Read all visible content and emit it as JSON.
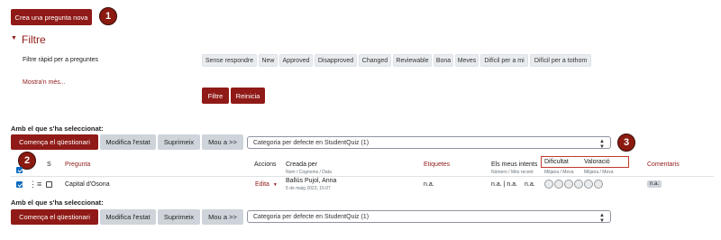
{
  "top": {
    "create_button": "Crea una pregunta nova",
    "callout_1": "1"
  },
  "filter": {
    "heading": "Filtre",
    "quick_label": "Filtre ràpid per a preguntes",
    "chips": [
      "Sense respondre",
      "New",
      "Approved",
      "Disapproved",
      "Changed",
      "Reviewable",
      "Bona",
      "Meves",
      "Difícil per a mi",
      "Difícil per a tothom"
    ],
    "show_more": "Mostra'n més...",
    "filter_button": "Filtre",
    "reset_button": "Reinicia"
  },
  "bulk_top": {
    "label": "Amb el que s'ha seleccionat:",
    "start_quiz": "Comença el qüestionari",
    "modify_state": "Modifica l'estat",
    "delete": "Suprimeix",
    "move": "Mou a >>",
    "category": "Categoria per defecte en StudentQuiz (1)"
  },
  "callouts": {
    "two": "2",
    "three": "3"
  },
  "table": {
    "headers": {
      "s": "S",
      "question": "Pregunta",
      "actions": "Accions",
      "created_by": "Creada per",
      "created_by_sub": "Nom / Cognoms / Data",
      "tags": "Etiquetes",
      "my_attempts": "Els meus intents",
      "my_attempts_sub": "Número / Més recent",
      "difficulty": "Dificultat",
      "difficulty_sub": "Mitjana / Meva",
      "rating": "Valoració",
      "rating_sub": "Mitjana / Meva",
      "comments": "Comentaris"
    },
    "row": {
      "question": "Capital d'Osona",
      "action": "Edita",
      "author": "Ballús Pujol, Anna",
      "date": "5 de maig 2023, 15:07",
      "tags": "n.a.",
      "attempts": "n.a. | n.a.",
      "difficulty": "n.a.",
      "comments": "n.a."
    }
  },
  "bulk_bottom": {
    "label": "Amb el que s'ha seleccionat:",
    "start_quiz": "Comença el qüestionari",
    "modify_state": "Modifica l'estat",
    "delete": "Suprimeix",
    "move": "Mou a >>",
    "category": "Categoria per defecte en StudentQuiz (1)"
  },
  "colors": {
    "primary": "#8f1a17",
    "callout": "#8b1a10",
    "checkbox": "#0f6cbf",
    "grey_button": "#ced4da"
  }
}
